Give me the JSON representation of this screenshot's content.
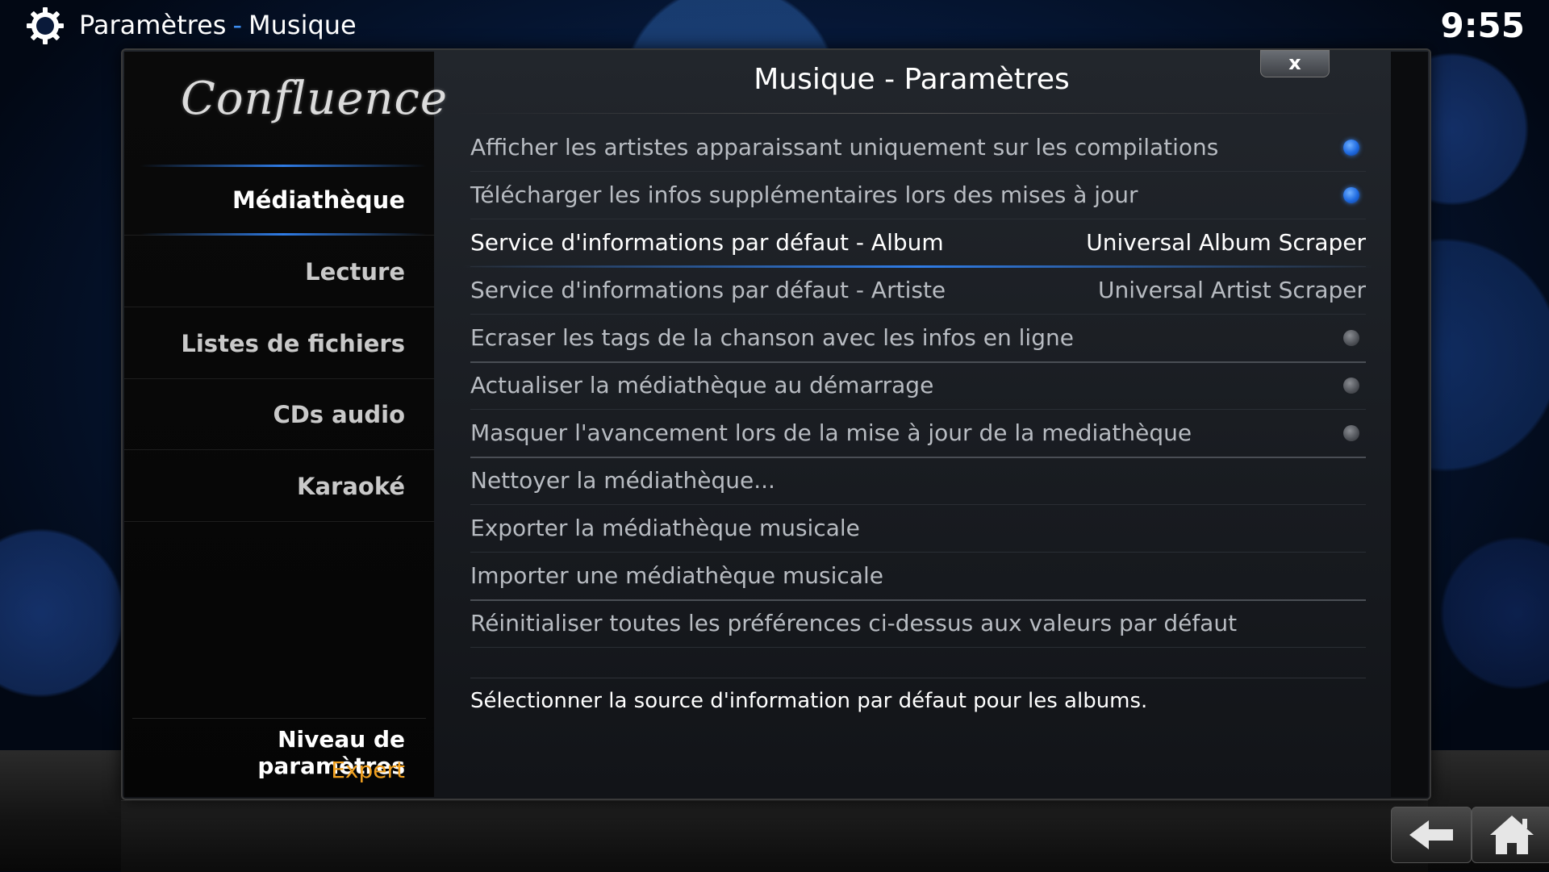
{
  "header": {
    "section": "Paramètres",
    "separator": "-",
    "subsection": "Musique",
    "clock": "9:55"
  },
  "sidebar": {
    "logo": "Confluence",
    "categories": [
      {
        "label": "Médiathèque",
        "active": true
      },
      {
        "label": "Lecture",
        "active": false
      },
      {
        "label": "Listes de fichiers",
        "active": false
      },
      {
        "label": "CDs audio",
        "active": false
      },
      {
        "label": "Karaoké",
        "active": false
      }
    ],
    "settings_level_label": "Niveau de paramètres",
    "settings_level_value": "Expert"
  },
  "dialog": {
    "title": "Musique - Paramètres",
    "close_label": "x",
    "settings": [
      {
        "label": "Afficher les artistes apparaissant uniquement sur les compilations",
        "type": "toggle",
        "enabled": true
      },
      {
        "label": "Télécharger les infos supplémentaires lors des mises à jour",
        "type": "toggle",
        "enabled": true
      },
      {
        "label": "Service d'informations par défaut - Album",
        "type": "value",
        "value": "Universal Album Scraper",
        "focused": true
      },
      {
        "label": "Service d'informations par défaut - Artiste",
        "type": "value",
        "value": "Universal Artist Scraper"
      },
      {
        "label": "Ecraser les tags de la chanson avec les infos en ligne",
        "type": "toggle",
        "enabled": false
      },
      {
        "label": "Actualiser la médiathèque au démarrage",
        "type": "toggle",
        "enabled": false
      },
      {
        "label": "Masquer l'avancement lors de la mise à jour de la mediathèque",
        "type": "toggle",
        "enabled": false
      },
      {
        "label": "Nettoyer la médiathèque...",
        "type": "action"
      },
      {
        "label": "Exporter la médiathèque musicale",
        "type": "action"
      },
      {
        "label": "Importer une médiathèque musicale",
        "type": "action"
      },
      {
        "label": "Réinitialiser toutes les préférences ci-dessus aux valeurs par défaut",
        "type": "action"
      }
    ],
    "description": "Sélectionner la source d'information par défaut pour les albums."
  },
  "colors": {
    "accent": "#2f7ce6",
    "level_value": "#f0a020",
    "toggle_on": "#1f6ae0",
    "toggle_off": "#4d5056"
  },
  "footer": {
    "back_icon": "back-arrow-icon",
    "home_icon": "home-icon"
  }
}
